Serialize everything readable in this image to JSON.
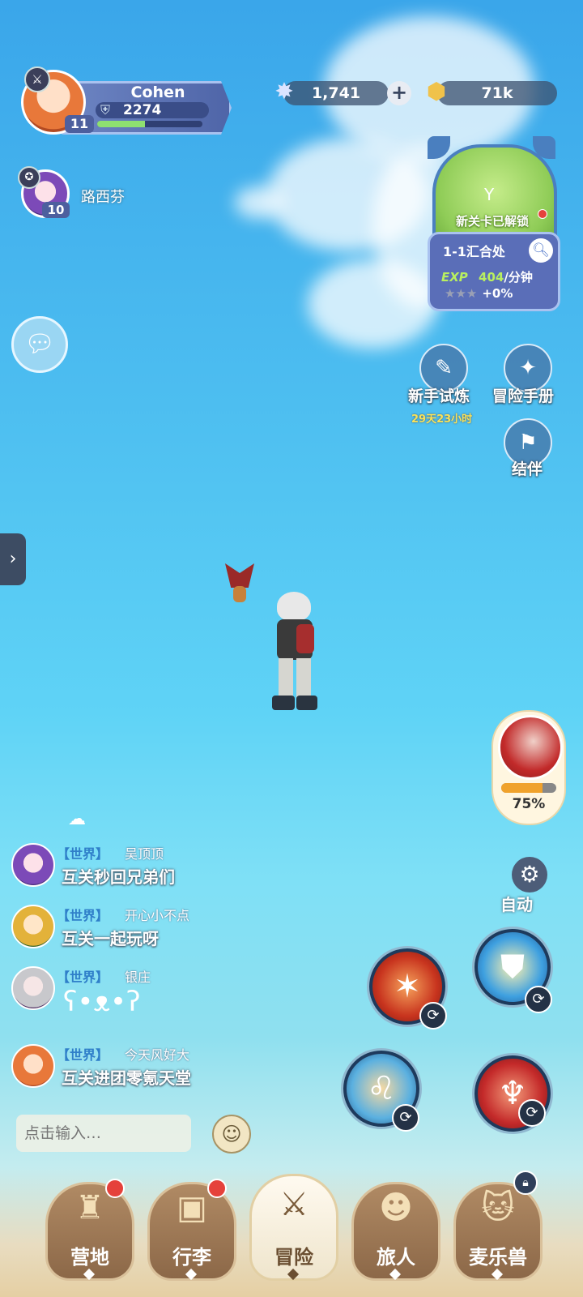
{
  "player": {
    "name": "Cohen",
    "power": "2274",
    "level": "11",
    "xp_fraction": 0.45
  },
  "companion": {
    "name": "路西芬",
    "level": "10"
  },
  "resources": {
    "gems": "1,741",
    "gold": "71k"
  },
  "map_card": {
    "unlock_text": "新关卡已解锁",
    "stage": "1-1汇合处",
    "exp_label": "EXP",
    "exp_rate": "404",
    "exp_unit": "/分钟",
    "stars": "★★★",
    "bonus": "+0%"
  },
  "side_buttons": {
    "trial_label": "新手试炼",
    "trial_timer": "29天23小时",
    "handbook_label": "冒险手册",
    "partner_label": "结伴"
  },
  "pet": {
    "percent_text": "75%",
    "fill_fraction": 0.75
  },
  "chat": {
    "messages": [
      {
        "channel": "【世界】",
        "user": "吴顶顶",
        "text": "互关秒回兄弟们"
      },
      {
        "channel": "【世界】",
        "user": "开心小不点",
        "text": "互关一起玩呀"
      },
      {
        "channel": "【世界】",
        "user": "银庄",
        "text": ""
      },
      {
        "channel": "【世界】",
        "user": "今天风好大",
        "text": "互关进团零氪天堂"
      }
    ],
    "input_placeholder": "点击输入…"
  },
  "auto_label": "自动",
  "nav": {
    "items": [
      {
        "label": "营地"
      },
      {
        "label": "行李"
      },
      {
        "label": "冒险"
      },
      {
        "label": "旅人"
      },
      {
        "label": "麦乐兽"
      }
    ]
  },
  "colors": {
    "sky_top": "#3aa6ea",
    "sky_bottom": "#8fe0ef",
    "nav_brown": "#8c6848",
    "exp_green": "#b9ef5f"
  }
}
